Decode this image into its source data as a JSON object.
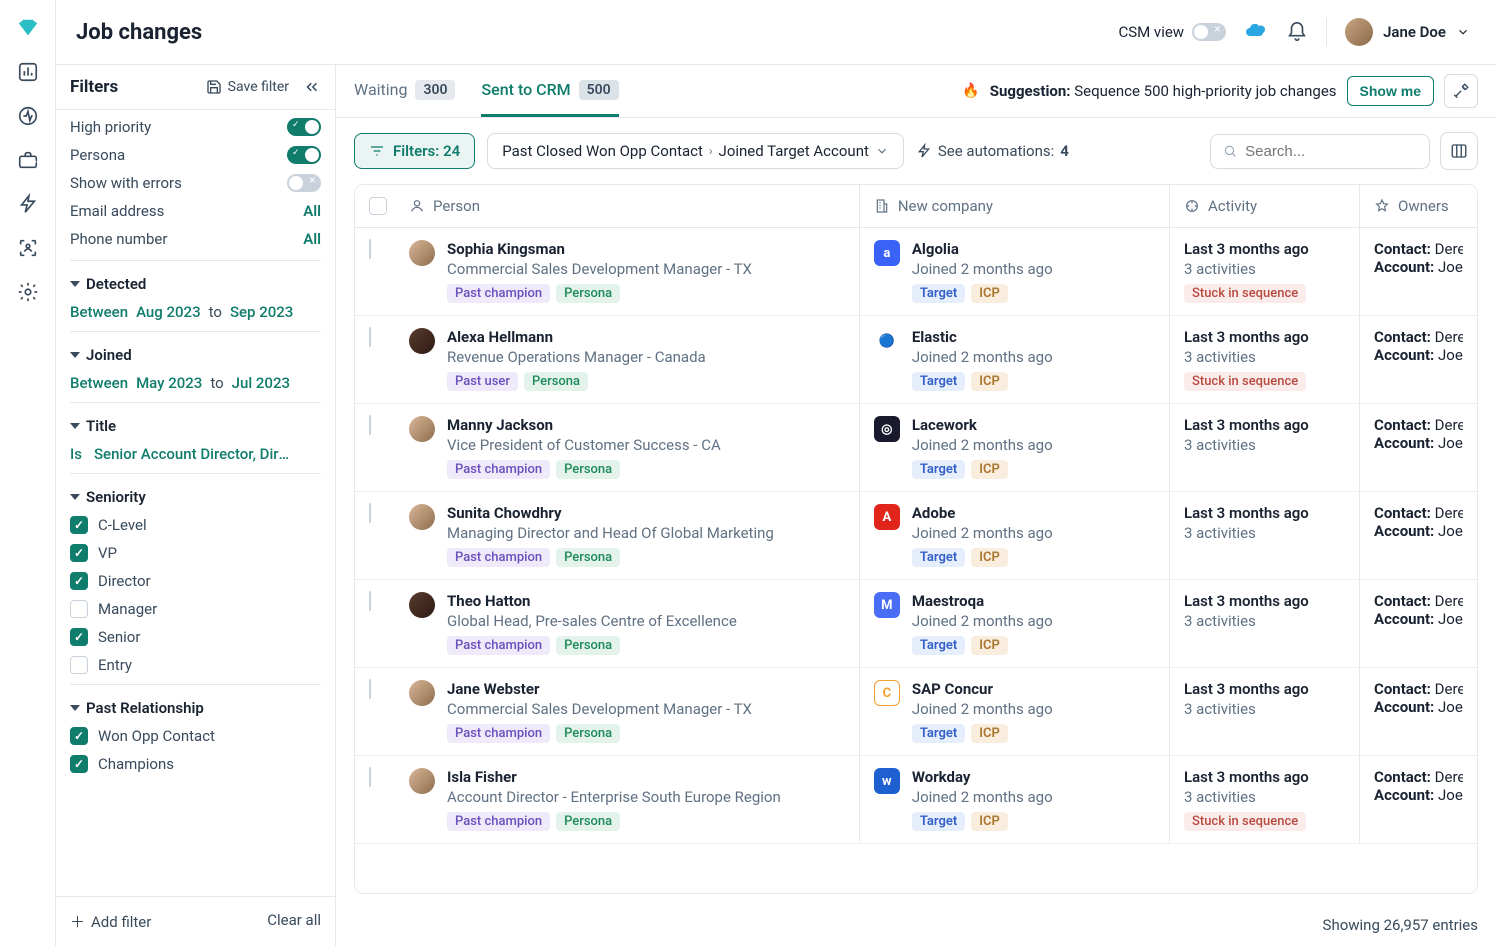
{
  "page_title": "Job changes",
  "user": {
    "name": "Jane Doe"
  },
  "topbar": {
    "csm_label": "CSM view"
  },
  "filters_panel": {
    "title": "Filters",
    "save_label": "Save filter",
    "add_filter_label": "Add filter",
    "clear_all_label": "Clear all",
    "quick": [
      {
        "label": "High priority",
        "type": "toggle",
        "on": true
      },
      {
        "label": "Persona",
        "type": "toggle",
        "on": true
      },
      {
        "label": "Show with errors",
        "type": "toggle",
        "on": false
      },
      {
        "label": "Email address",
        "type": "all",
        "value": "All"
      },
      {
        "label": "Phone number",
        "type": "all",
        "value": "All"
      }
    ],
    "sections": {
      "detected": {
        "title": "Detected",
        "between": "Between",
        "from": "Aug 2023",
        "to_word": "to",
        "to": "Sep 2023"
      },
      "joined": {
        "title": "Joined",
        "between": "Between",
        "from": "May 2023",
        "to_word": "to",
        "to": "Jul 2023"
      },
      "title": {
        "title": "Title",
        "op": "Is",
        "value": "Senior Account Director, Direc..."
      },
      "seniority": {
        "title": "Seniority",
        "options": [
          {
            "label": "C-Level",
            "checked": true
          },
          {
            "label": "VP",
            "checked": true
          },
          {
            "label": "Director",
            "checked": true
          },
          {
            "label": "Manager",
            "checked": false
          },
          {
            "label": "Senior",
            "checked": true
          },
          {
            "label": "Entry",
            "checked": false
          }
        ]
      },
      "past_relationship": {
        "title": "Past Relationship",
        "options": [
          {
            "label": "Won Opp Contact",
            "checked": true
          },
          {
            "label": "Champions",
            "checked": true
          }
        ]
      }
    }
  },
  "tabs": [
    {
      "label": "Waiting",
      "count": "300",
      "active": false
    },
    {
      "label": "Sent to CRM",
      "count": "500",
      "active": true
    }
  ],
  "suggestion": {
    "emoji": "🔥",
    "prefix": "Suggestion:",
    "text": " Sequence 500 high-priority job changes",
    "cta": "Show me"
  },
  "controls": {
    "filters_button": "Filters: 24",
    "breadcrumb_left": "Past Closed Won Opp Contact",
    "breadcrumb_right": "Joined Target Account",
    "automations_label": "See automations:",
    "automations_count": "4",
    "search_placeholder": "Search..."
  },
  "columns": {
    "person": "Person",
    "company": "New company",
    "activity": "Activity",
    "owners": "Owners"
  },
  "rows": [
    {
      "name": "Sophia Kingsman",
      "title": "Commercial Sales Development Manager - TX",
      "tags": [
        "Past champion",
        "Persona"
      ],
      "company": "Algolia",
      "logo_bg": "#3b62f6",
      "logo_txt": "a",
      "joined": "Joined 2 months ago",
      "ctarget": "Target",
      "cicp": "ICP",
      "activity_when": "Last 3 months ago",
      "activity_cnt": "3 activities",
      "stuck": "Stuck in sequence",
      "owner_contact": "Contact: Derek",
      "owner_account": "Account: Joe J"
    },
    {
      "name": "Alexa Hellmann",
      "title": "Revenue Operations Manager - Canada",
      "tags": [
        "Past user",
        "Persona"
      ],
      "company": "Elastic",
      "logo_bg": "#ffffff",
      "logo_txt": "🔵",
      "joined": "Joined 2 months ago",
      "ctarget": "Target",
      "cicp": "ICP",
      "activity_when": "Last 3 months ago",
      "activity_cnt": "3 activities",
      "stuck": "Stuck in sequence",
      "owner_contact": "Contact: Derek",
      "owner_account": "Account: Joe J"
    },
    {
      "name": "Manny Jackson",
      "title": "Vice President of Customer Success - CA",
      "tags": [
        "Past champion",
        "Persona"
      ],
      "company": "Lacework",
      "logo_bg": "#1a1a2e",
      "logo_txt": "◎",
      "joined": "Joined 2 months ago",
      "ctarget": "Target",
      "cicp": "ICP",
      "activity_when": "Last 3 months ago",
      "activity_cnt": "3 activities",
      "stuck": "",
      "owner_contact": "Contact: Derek",
      "owner_account": "Account: Joe J"
    },
    {
      "name": "Sunita Chowdhry",
      "title": "Managing Director and Head Of Global Marketing",
      "tags": [
        "Past champion",
        "Persona"
      ],
      "company": "Adobe",
      "logo_bg": "#e1251b",
      "logo_txt": "A",
      "joined": "Joined 2 months ago",
      "ctarget": "Target",
      "cicp": "ICP",
      "activity_when": "Last 3 months ago",
      "activity_cnt": "3 activities",
      "stuck": "",
      "owner_contact": "Contact: Derek",
      "owner_account": "Account: Joe J"
    },
    {
      "name": "Theo Hatton",
      "title": "Global Head, Pre-sales Centre of Excellence",
      "tags": [
        "Past champion",
        "Persona"
      ],
      "company": "Maestroqa",
      "logo_bg": "#4a6df5",
      "logo_txt": "M",
      "joined": "Joined 2 months ago",
      "ctarget": "Target",
      "cicp": "ICP",
      "activity_when": "Last 3 months ago",
      "activity_cnt": "3 activities",
      "stuck": "",
      "owner_contact": "Contact: Derek",
      "owner_account": "Account: Joe J"
    },
    {
      "name": "Jane Webster",
      "title": "Commercial Sales Development Manager - TX",
      "tags": [
        "Past champion",
        "Persona"
      ],
      "company": "SAP Concur",
      "logo_bg": "#ffffff",
      "logo_txt": "C",
      "joined": "Joined 2 months ago",
      "ctarget": "Target",
      "cicp": "ICP",
      "activity_when": "Last 3 months ago",
      "activity_cnt": "3 activities",
      "stuck": "",
      "owner_contact": "Contact: Derek",
      "owner_account": "Account: Joe J"
    },
    {
      "name": "Isla Fisher",
      "title": "Account Director - Enterprise South Europe Region",
      "tags": [
        "Past champion",
        "Persona"
      ],
      "company": "Workday",
      "logo_bg": "#1f60d1",
      "logo_txt": "w",
      "joined": "Joined 2 months ago",
      "ctarget": "Target",
      "cicp": "ICP",
      "activity_when": "Last 3 months ago",
      "activity_cnt": "3 activities",
      "stuck": "Stuck in sequence",
      "owner_contact": "Contact: Derek",
      "owner_account": "Account: Joe J"
    }
  ],
  "footer": {
    "showing": "Showing 26,957 entries"
  }
}
